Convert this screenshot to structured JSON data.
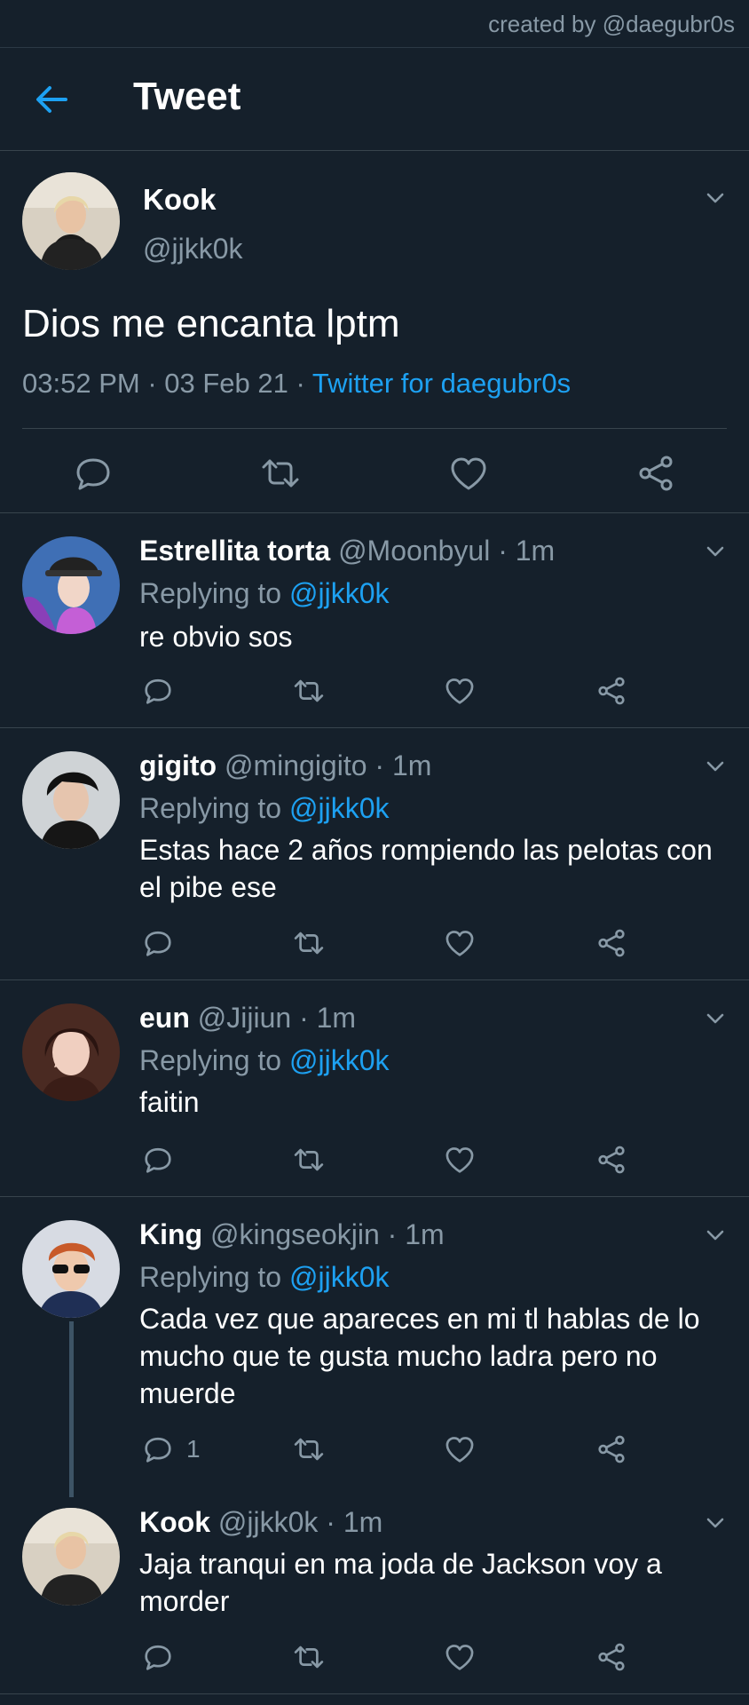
{
  "credit": "created by @daegubr0s",
  "header": {
    "title": "Tweet"
  },
  "main_tweet": {
    "name": "Kook",
    "handle": "@jjkk0k",
    "text": "Dios me encanta lptm",
    "time": "03:52 PM",
    "date": "03 Feb 21",
    "source": "Twitter for daegubr0s"
  },
  "replies": [
    {
      "name": "Estrellita torta",
      "handle": "@Moonbyul",
      "ago": "1m",
      "replying_label": "Replying to",
      "replying_to": "@jjkk0k",
      "text": "re obvio sos"
    },
    {
      "name": "gigito",
      "handle": "@mingigito",
      "ago": "1m",
      "replying_label": "Replying to",
      "replying_to": "@jjkk0k",
      "text": "Estas hace 2 años rompiendo las pelotas con el pibe ese"
    },
    {
      "name": "eun",
      "handle": "@Jijiun",
      "ago": "1m",
      "replying_label": "Replying to",
      "replying_to": "@jjkk0k",
      "text": "faitin"
    },
    {
      "name": "King",
      "handle": "@kingseokjin",
      "ago": "1m",
      "replying_label": "Replying to",
      "replying_to": "@jjkk0k",
      "text": "Cada vez que apareces en mi tl hablas de lo mucho que te gusta mucho ladra pero no muerde",
      "reply_count": "1"
    },
    {
      "name": "Kook",
      "handle": "@jjkk0k",
      "ago": "1m",
      "text": "Jaja tranqui en ma joda de Jackson voy a morder"
    }
  ],
  "colors": {
    "background": "#15202b",
    "accent": "#1da1f2",
    "secondary_text": "#8899a6",
    "border": "#38444d"
  },
  "icons": [
    "back-arrow-icon",
    "chevron-down-icon",
    "reply-icon",
    "retweet-icon",
    "like-icon",
    "share-icon"
  ]
}
